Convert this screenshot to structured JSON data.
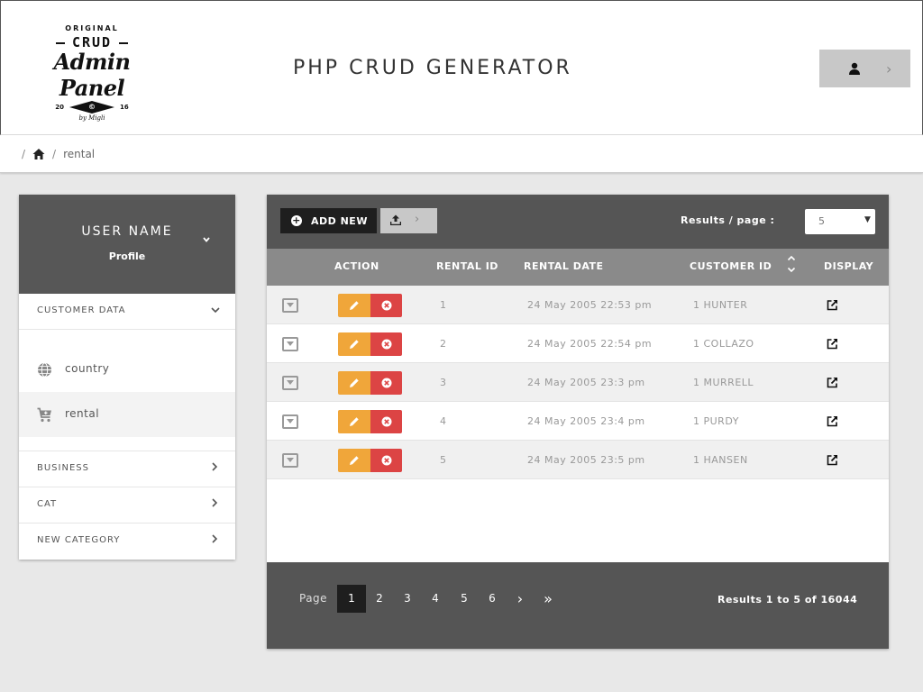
{
  "header": {
    "logo": {
      "line1": "ORIGINAL",
      "line2": "CRUD",
      "line3": "Admin Panel",
      "year_left": "20",
      "year_mark": "©",
      "year_right": "16",
      "byline": "by Migli"
    },
    "title": "PHP CRUD GENERATOR",
    "user_icon": "user-icon",
    "chevron": "›"
  },
  "breadcrumb": {
    "sep": "/",
    "home_icon": "home-icon",
    "current": "rental"
  },
  "sidebar": {
    "user_name": "USER NAME",
    "profile": "Profile",
    "caret": "⌄",
    "sections": [
      {
        "label": "CUSTOMER DATA",
        "chev": "⌄"
      },
      {
        "label": "BUSINESS",
        "chev": "›"
      },
      {
        "label": "CAT",
        "chev": "›"
      },
      {
        "label": "NEW CATEGORY",
        "chev": "›"
      }
    ],
    "sub_items": [
      {
        "label": "country",
        "icon": "globe-icon"
      },
      {
        "label": "rental",
        "icon": "cart-icon"
      }
    ]
  },
  "toolbar": {
    "add_label": "ADD NEW",
    "add_plus": "+",
    "export_icon": "upload-icon",
    "export_chev": "›",
    "rpp_label": "Results / page :",
    "rpp_value": "5",
    "rpp_caret": "▼"
  },
  "table": {
    "headers": {
      "action": "ACTION",
      "rental_id": "RENTAL ID",
      "rental_date": "RENTAL DATE",
      "customer_id": "CUSTOMER ID",
      "display": "DISPLAY"
    },
    "rows": [
      {
        "id": "1",
        "date": "24 May 2005 22:53 pm",
        "customer": "1 HUNTER"
      },
      {
        "id": "2",
        "date": "24 May 2005 22:54 pm",
        "customer": "1 COLLAZO"
      },
      {
        "id": "3",
        "date": "24 May 2005 23:3 pm",
        "customer": "1 MURRELL"
      },
      {
        "id": "4",
        "date": "24 May 2005 23:4 pm",
        "customer": "1 PURDY"
      },
      {
        "id": "5",
        "date": "24 May 2005 23:5 pm",
        "customer": "1 HANSEN"
      }
    ]
  },
  "pager": {
    "label": "Page",
    "pages": [
      "1",
      "2",
      "3",
      "4",
      "5",
      "6"
    ],
    "next": "›",
    "last": "»",
    "active": "1",
    "results": "Results 1 to 5 of 16044"
  },
  "colors": {
    "dark": "#555555",
    "header_row": "#8a8a8a",
    "edit": "#f0a63a",
    "delete": "#dc4444",
    "black_btn": "#1e1e1e"
  }
}
